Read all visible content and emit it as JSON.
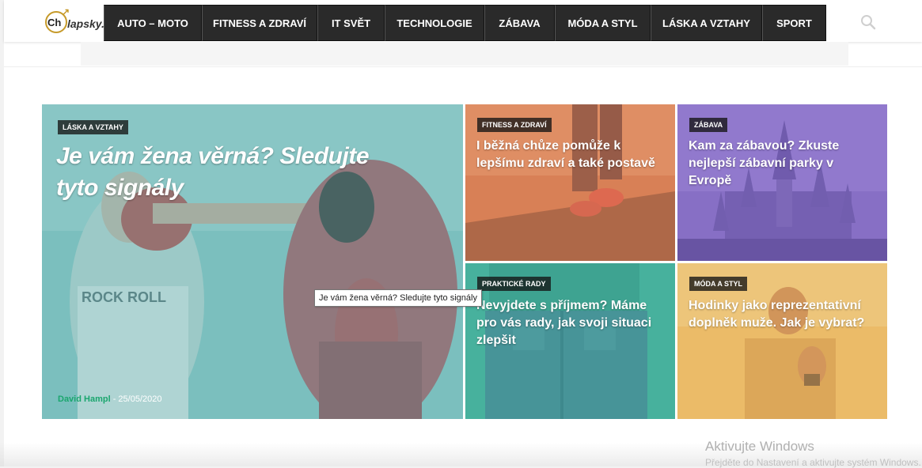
{
  "logo": {
    "part1": "Ch",
    "part2": "lapsky."
  },
  "nav": [
    {
      "label": "AUTO – MOTO",
      "w": 124
    },
    {
      "label": "FITNESS A ZDRAVÍ",
      "w": 146
    },
    {
      "label": "IT SVĚT",
      "w": 85
    },
    {
      "label": "TECHNOLOGIE",
      "w": 126
    },
    {
      "label": "ZÁBAVA",
      "w": 89
    },
    {
      "label": "MÓDA A STYL",
      "w": 121
    },
    {
      "label": "LÁSKA A VZTAHY",
      "w": 141
    },
    {
      "label": "SPORT",
      "w": 81
    }
  ],
  "featured": {
    "category": "LÁSKA A VZTAHY",
    "title_line1": "Je vám žena věrná? Sledujte",
    "title_line2": "tyto signály",
    "author": "David Hampl",
    "date": "- 25/05/2020"
  },
  "cards": [
    {
      "category": "FITNESS A ZDRAVÍ",
      "line1": "I běžná chůze pomůže k",
      "line2": "lepšímu zdraví a také postavě",
      "line3": ""
    },
    {
      "category": "ZÁBAVA",
      "line1": "Kam za zábavou? Zkuste",
      "line2": "nejlepší zábavní parky v",
      "line3": "Evropě"
    },
    {
      "category": "PRAKTICKÉ RADY",
      "line1": "Nevyjdete s příjmem? Máme",
      "line2": "pro vás rady, jak svoji situaci",
      "line3": "zlepšit"
    },
    {
      "category": "MÓDA A STYL",
      "line1": "Hodinky jako reprezentativní",
      "line2": "doplněk muže. Jak je vybrat?",
      "line3": ""
    }
  ],
  "tooltip": "Je vám žena věrná? Sledujte tyto signály",
  "watermark": {
    "line1": "Aktivujte Windows",
    "line2": "Přejděte do Nastavení a aktivujte systém Windows."
  },
  "colors": {
    "nav_bg": "#2a2a2a",
    "featured_overlay": "#5fb6b6",
    "fitness_overlay": "#d9794b",
    "zabava_overlay": "#7a5fbd",
    "rady_overlay": "#3fb09a",
    "moda_overlay": "#e4b25a",
    "author": "#1aa66e"
  },
  "icons": {
    "search": "search-icon"
  }
}
